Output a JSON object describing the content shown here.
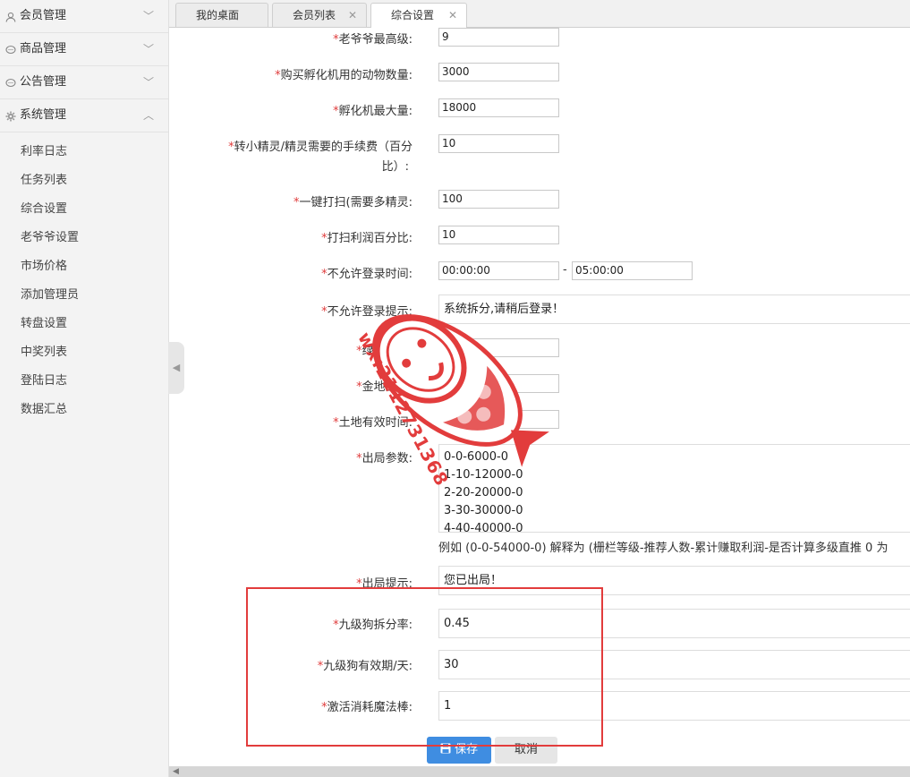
{
  "sidebar": {
    "groups": [
      {
        "label": "会员管理",
        "icon": "user-icon"
      },
      {
        "label": "商品管理",
        "icon": "chat-icon"
      },
      {
        "label": "公告管理",
        "icon": "chat-icon"
      },
      {
        "label": "系统管理",
        "icon": "gear-icon"
      }
    ],
    "sub_items": [
      {
        "label": "利率日志"
      },
      {
        "label": "任务列表"
      },
      {
        "label": "综合设置"
      },
      {
        "label": "老爷爷设置"
      },
      {
        "label": "市场价格"
      },
      {
        "label": "添加管理员"
      },
      {
        "label": "转盘设置"
      },
      {
        "label": "中奖列表"
      },
      {
        "label": "登陆日志"
      },
      {
        "label": "数据汇总"
      }
    ]
  },
  "tabs": [
    {
      "label": "我的桌面"
    },
    {
      "label": "会员列表"
    },
    {
      "label": "综合设置"
    }
  ],
  "form": {
    "required_mark": "*",
    "fields": [
      {
        "label": "老爷爷最高级:",
        "value": "9"
      },
      {
        "label": "购买孵化机用的动物数量:",
        "value": "3000"
      },
      {
        "label": "孵化机最大量:",
        "value": "18000"
      },
      {
        "label": "转小精灵/精灵需要的手续费（百分",
        "label_cont": "比）:",
        "value": "10"
      },
      {
        "label": "一键打扫(需要多精灵:",
        "value": "100"
      },
      {
        "label": "打扫利润百分比:",
        "value": "10"
      },
      {
        "label": "不允许登录时间:",
        "value": "00:00:00",
        "value2": "05:00:00",
        "sep": "-"
      },
      {
        "label": "不允许登录提示:",
        "value": "系统拆分,请稍后登录！"
      },
      {
        "label": "绿地上限:",
        "value": "1000"
      },
      {
        "label": "金地上限:",
        "value": "30000"
      },
      {
        "label": "土地有效时间:",
        "value": "10000"
      },
      {
        "label": "出局参数:",
        "lines": [
          "0-0-6000-0",
          "1-10-12000-0",
          "2-20-20000-0",
          "3-30-30000-0",
          "4-40-40000-0"
        ]
      },
      {
        "label": "出局提示:",
        "value": "您已出局！"
      },
      {
        "label": "九级狗拆分率:",
        "value": "0.45"
      },
      {
        "label": "九级狗有效期/天:",
        "value": "30"
      },
      {
        "label": "激活消耗魔法棒:",
        "value": "1"
      }
    ],
    "example_hint": "例如 (0-0-54000-0) 解释为 (栅栏等级-推荐人数-累计赚取利润-是否计算多级直推 0 为",
    "save_label": "保存",
    "cancel_label": "取消"
  },
  "watermark": {
    "text": "wx:2112731368"
  },
  "colors": {
    "required": "#e03c3c",
    "save_button": "#3f8de1",
    "highlight_box": "#e23c3c"
  }
}
